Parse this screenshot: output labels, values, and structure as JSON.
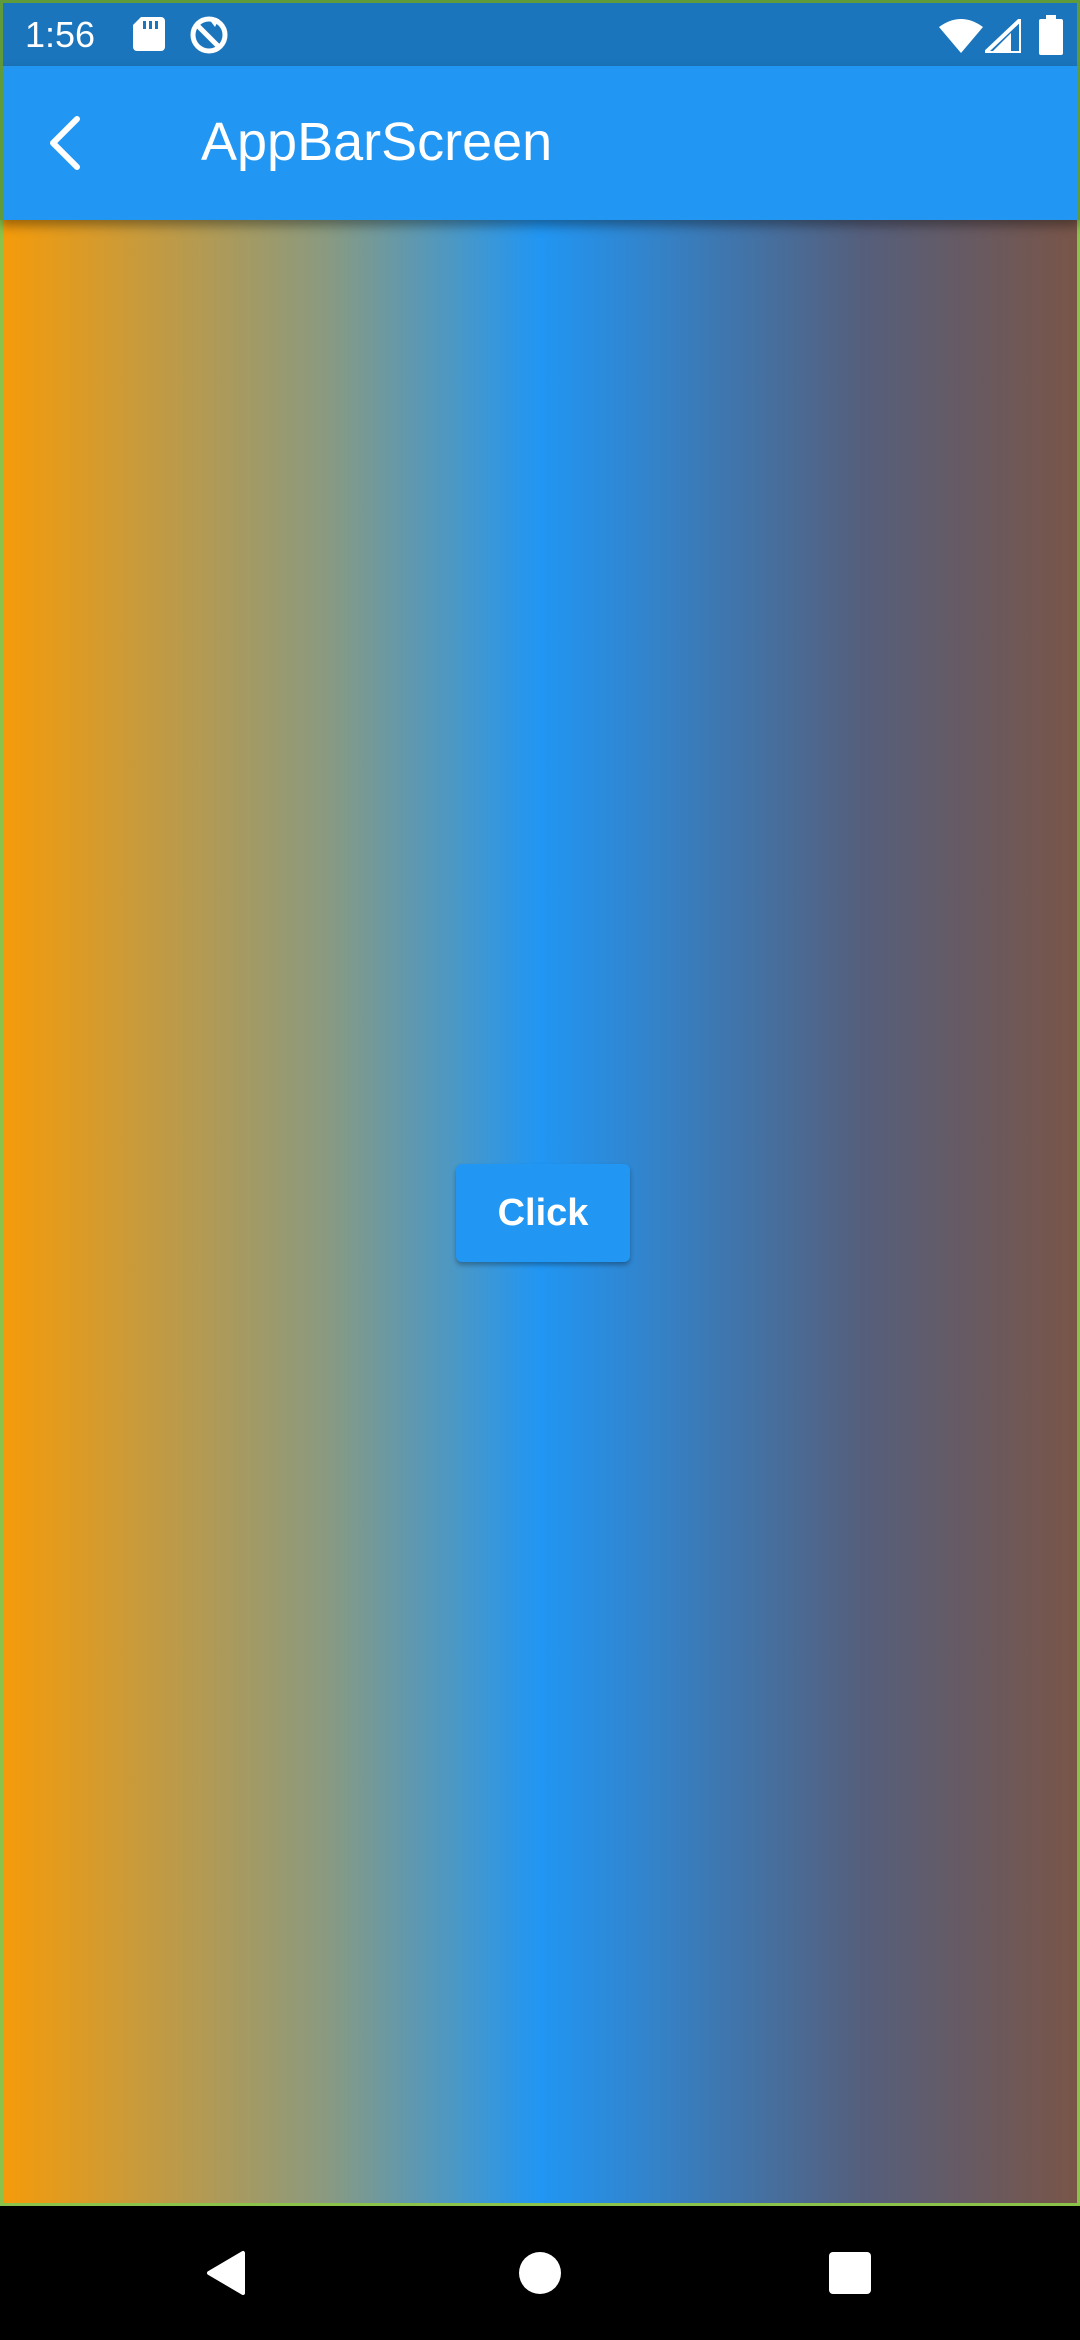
{
  "status_bar": {
    "time": "1:56",
    "icons": [
      "sd-card-icon",
      "sync-icon",
      "wifi-icon",
      "signal-icon",
      "battery-icon"
    ]
  },
  "app_bar": {
    "title": "AppBarScreen",
    "back_icon": "arrow-back-icon",
    "color": "#2196f3"
  },
  "body": {
    "gradient_colors": [
      "#f59b0a",
      "#2196f3",
      "#795548"
    ],
    "button_label": "Click"
  },
  "nav_bar": {
    "icons": [
      "nav-back-icon",
      "nav-home-icon",
      "nav-recents-icon"
    ]
  }
}
